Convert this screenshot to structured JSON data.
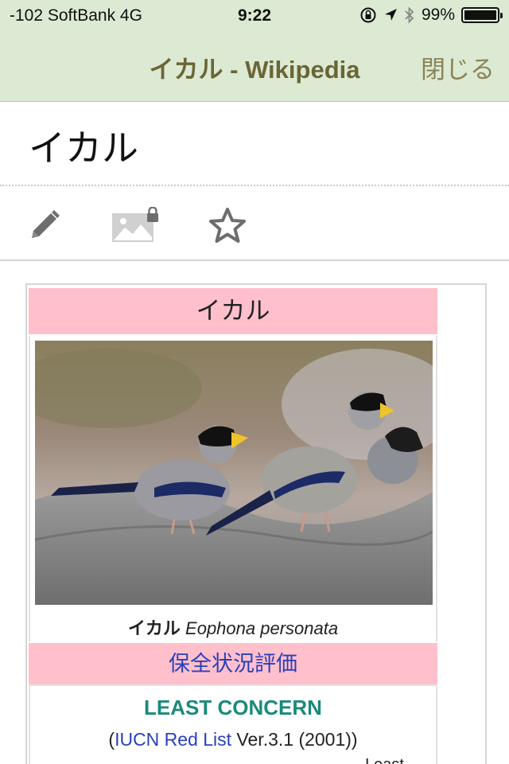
{
  "status_bar": {
    "carrier": "-102 SoftBank   4G",
    "time": "9:22",
    "battery": "99%",
    "battery_level": 0.99
  },
  "nav": {
    "title": "イカル - Wikipedia",
    "close_label": "閉じる"
  },
  "article": {
    "title": "イカル"
  },
  "toolbar": {
    "icons": [
      "pencil-icon",
      "image-lock-icon",
      "star-icon"
    ]
  },
  "infobox": {
    "header": "イカル",
    "caption_jp": "イカル",
    "caption_latin": "Eophona personata",
    "status_header": "保全状況評価",
    "status_value": "LEAST CONCERN",
    "iucn_open": "(",
    "iucn_link": "IUCN Red List",
    "iucn_rest": " Ver.3.1 (2001))",
    "truncated_text": "Least"
  },
  "colors": {
    "header_bg": "#dcead3",
    "nav_title": "#6b6536",
    "infobox_pink": "#ffc0cb",
    "link_blue": "#2a3fbd",
    "least_concern": "#1a8a7a"
  }
}
